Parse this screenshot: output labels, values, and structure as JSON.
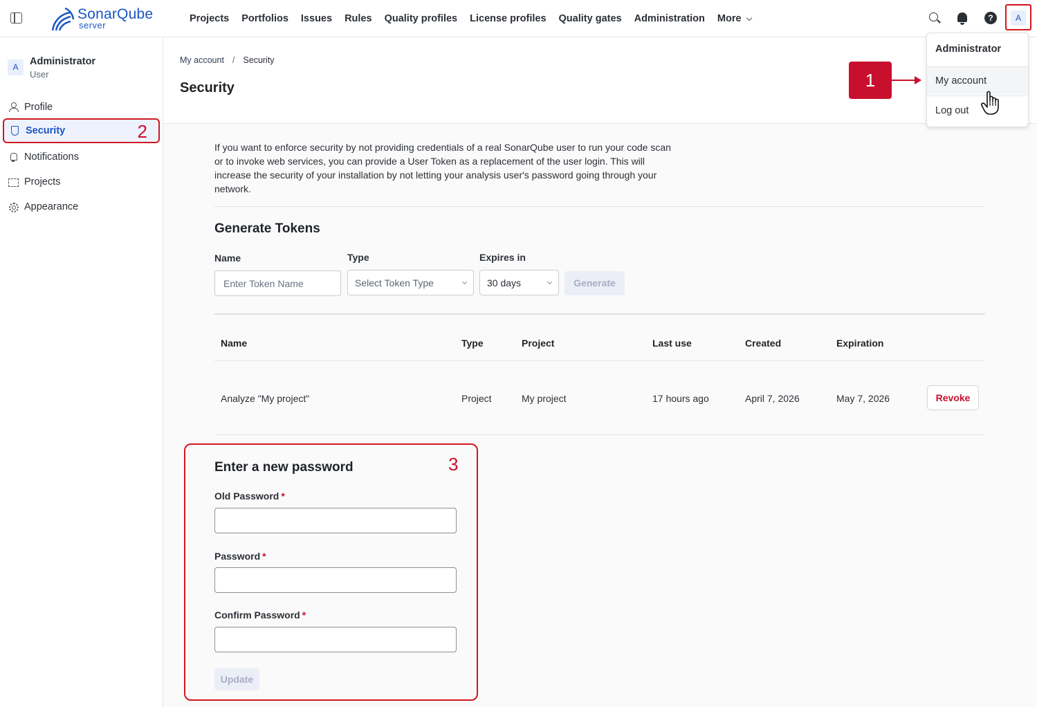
{
  "topnav": {
    "logo_name": "SonarQube",
    "logo_sub": "server",
    "items": [
      "Projects",
      "Portfolios",
      "Issues",
      "Rules",
      "Quality profiles",
      "License profiles",
      "Quality gates",
      "Administration"
    ],
    "more_label": "More",
    "help_glyph": "?",
    "avatar_initial": "A"
  },
  "dropdown": {
    "name": "Administrator",
    "my_account": "My account",
    "log_out": "Log out"
  },
  "callouts": {
    "one": "1",
    "two": "2",
    "three": "3"
  },
  "sidebar": {
    "avatar_initial": "A",
    "user_name": "Administrator",
    "user_role": "User",
    "items": [
      {
        "label": "Profile",
        "icon": "person-icon"
      },
      {
        "label": "Security",
        "icon": "shield-icon"
      },
      {
        "label": "Notifications",
        "icon": "bell-icon"
      },
      {
        "label": "Projects",
        "icon": "folder-icon"
      },
      {
        "label": "Appearance",
        "icon": "gear-icon"
      }
    ]
  },
  "header": {
    "breadcrumb": [
      "My account",
      "Security"
    ],
    "breadcrumb_sep": "/",
    "title": "Security"
  },
  "intro": "If you want to enforce security by not providing credentials of a real SonarQube user to run your code scan or to invoke web services, you can provide a User Token as a replacement of the user login. This will increase the security of your installation by not letting your analysis user's password going through your network.",
  "tokens": {
    "title": "Generate Tokens",
    "name_label": "Name",
    "name_placeholder": "Enter Token Name",
    "type_label": "Type",
    "type_placeholder": "Select Token Type",
    "expires_label": "Expires in",
    "expires_value": "30 days",
    "generate_label": "Generate",
    "columns": [
      "Name",
      "Type",
      "Project",
      "Last use",
      "Created",
      "Expiration"
    ],
    "rows": [
      {
        "name": "Analyze \"My project\"",
        "type": "Project",
        "project": "My project",
        "last_use": "17 hours ago",
        "created": "April 7, 2026",
        "expiration": "May 7, 2026",
        "action": "Revoke"
      }
    ]
  },
  "password": {
    "title": "Enter a new password",
    "old_label": "Old Password",
    "new_label": "Password",
    "confirm_label": "Confirm Password",
    "required_mark": "*",
    "update_label": "Update"
  },
  "colors": {
    "brand": "#1a56c2",
    "callout_red": "#c8102e",
    "active_bg": "#eef2fd"
  }
}
